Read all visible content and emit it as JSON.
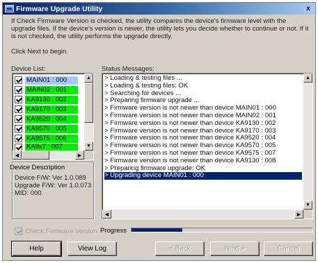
{
  "window": {
    "title": "Firmware Upgrade Utility",
    "close_glyph": "x"
  },
  "intro": {
    "text": "If Check Firmware Version is checked, the utility compares the device's firmware level with the upgrade files. If the device's version is newer, the utility lets you decide whether to continue or not. If it is not checked, the utility performs the upgrade directly.",
    "click_next": "Click Next to begin."
  },
  "device_list": {
    "label": "Device List:",
    "items": [
      {
        "label": "MAIN01 : 000",
        "checked": true,
        "selected": true
      },
      {
        "label": "MAIN02 : 001",
        "checked": true
      },
      {
        "label": "KA9130 : 002",
        "checked": true
      },
      {
        "label": "KA9170 : 003",
        "checked": true
      },
      {
        "label": "KA9520 : 004",
        "checked": true
      },
      {
        "label": "KA9570 : 005",
        "checked": true
      },
      {
        "label": "KA9575 : 006",
        "checked": true
      }
    ],
    "partial_item": "KA9x7 : 007"
  },
  "device_description": {
    "title": "Device Description",
    "lines": [
      "Device F/W: Ver 1.0.089",
      "Upgrade F/W: Ver 1.0.073",
      "MID: 000"
    ]
  },
  "status": {
    "label": "Status Messages:",
    "messages": [
      "> Loading & testing files ...",
      "> Loading & testing files: OK",
      "> Searching for devices ...",
      "> Preparing firmware upgrade ...",
      "> Firmware version is not newer than device MAIN01 : 000",
      "> Firmware version is not newer than device MAIN02 : 001",
      "> Firmware version is not newer than device KA9130 : 002",
      "> Firmware version is not newer than device KA9170 : 003",
      "> Firmware version is not newer than device KA9520 : 004",
      "> Firmware version is not newer than device KA9570 : 005",
      "> Firmware version is not newer than device KA9575 : 007",
      "> Firmware version is not newer than device KA9130 : 008",
      "> Preparing firmware upgrade: OK",
      "> Upgrading device MAIN01 : 000"
    ],
    "highlighted_index": 13
  },
  "options": {
    "check_firmware_label": "Check Firmware Version",
    "check_firmware_checked": true,
    "check_firmware_enabled": false
  },
  "progress": {
    "label": "Progress",
    "value": 0.28
  },
  "buttons": {
    "help": "Help",
    "view_log": "View Log",
    "back": "< Back",
    "next": "Next >",
    "cancel": "Cancel"
  },
  "colors": {
    "device_ok": "#00ee00",
    "selection": "#0a246a",
    "selected_device": "#a8c8f8"
  }
}
